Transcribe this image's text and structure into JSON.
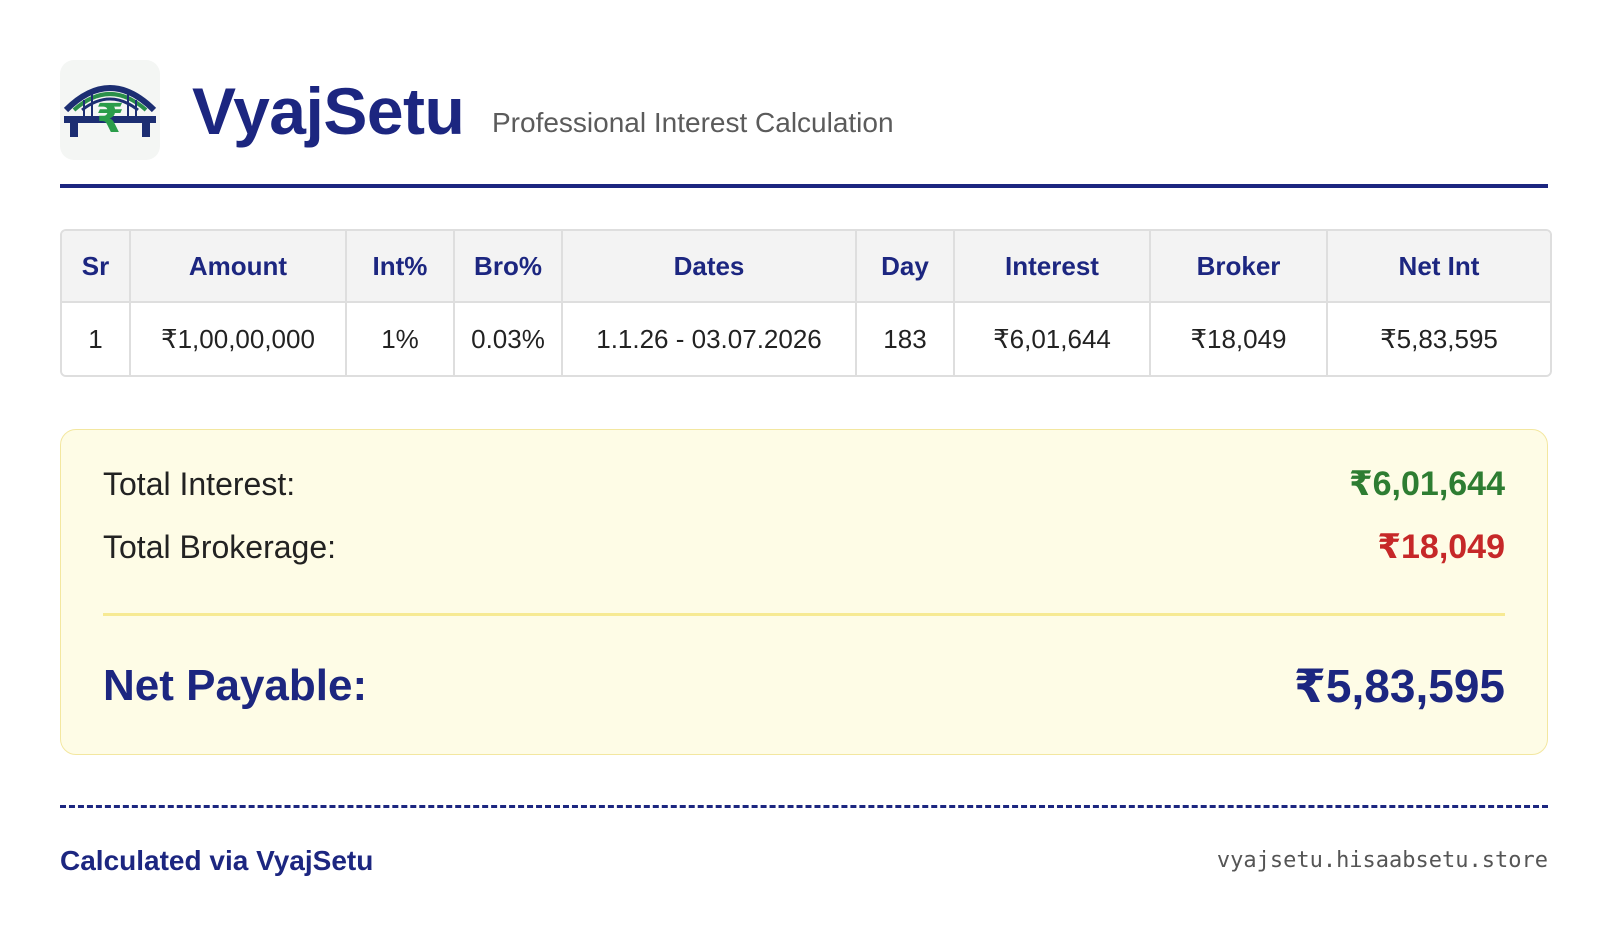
{
  "header": {
    "brand": "VyajSetu",
    "tagline": "Professional Interest Calculation",
    "logo_icon": "bridge-rupee-icon"
  },
  "table": {
    "columns": [
      "Sr",
      "Amount",
      "Int%",
      "Bro%",
      "Dates",
      "Day",
      "Interest",
      "Broker",
      "Net Int"
    ],
    "rows": [
      [
        "1",
        "₹1,00,00,000",
        "1%",
        "0.03%",
        "1.1.26 - 03.07.2026",
        "183",
        "₹6,01,644",
        "₹18,049",
        "₹5,83,595"
      ]
    ]
  },
  "summary": {
    "total_interest_label": "Total Interest:",
    "total_interest_value": "₹6,01,644",
    "total_brokerage_label": "Total Brokerage:",
    "total_brokerage_value": "₹18,049",
    "net_payable_label": "Net Payable:",
    "net_payable_value": "₹5,83,595"
  },
  "footer": {
    "left": "Calculated via VyajSetu",
    "right": "vyajsetu.hisaabsetu.store"
  },
  "colors": {
    "brand": "#1c2680",
    "interest": "#2e7d32",
    "brokerage": "#c62828",
    "summary_bg": "#fefce6"
  }
}
